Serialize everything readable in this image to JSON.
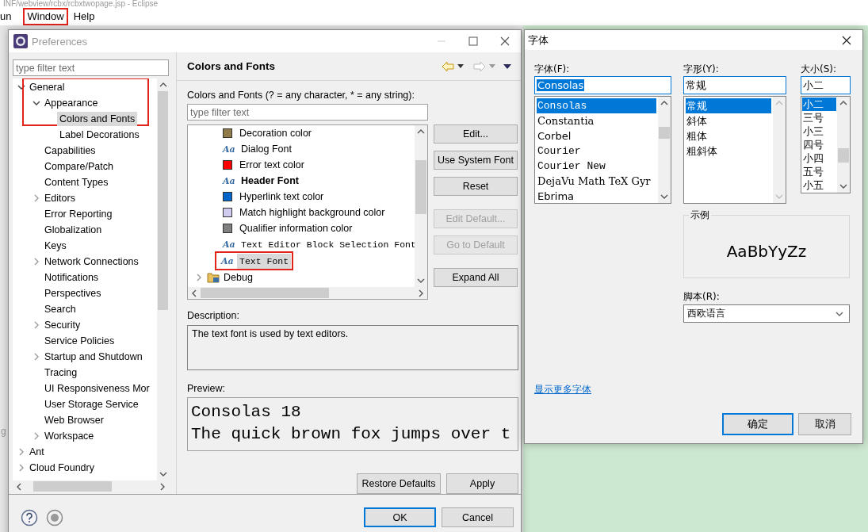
{
  "app_title": "INF/webview/rcbx/rcbxtwopage.jsp - Eclipse",
  "menu": [
    {
      "label": "un",
      "annotated": false
    },
    {
      "label": "Window",
      "annotated": true
    },
    {
      "label": "Help",
      "annotated": false
    }
  ],
  "edge_text": "g",
  "preferences": {
    "title": "Preferences",
    "filter_placeholder": "type filter text",
    "tree": [
      {
        "label": "General",
        "expanded": true,
        "selected": false,
        "annotated": true,
        "children": [
          {
            "label": "Appearance",
            "expanded": true,
            "selected": false,
            "children": [
              {
                "label": "Colors and Fonts",
                "selected": true
              },
              {
                "label": "Label Decorations",
                "selected": false
              }
            ]
          },
          {
            "label": "Capabilities",
            "selected": false
          },
          {
            "label": "Compare/Patch",
            "selected": false
          },
          {
            "label": "Content Types",
            "selected": false
          },
          {
            "label": "Editors",
            "expanded": false,
            "selected": false
          },
          {
            "label": "Error Reporting",
            "selected": false
          },
          {
            "label": "Globalization",
            "selected": false
          },
          {
            "label": "Keys",
            "selected": false
          },
          {
            "label": "Network Connections",
            "expanded": false,
            "selected": false
          },
          {
            "label": "Notifications",
            "selected": false
          },
          {
            "label": "Perspectives",
            "selected": false
          },
          {
            "label": "Search",
            "selected": false
          },
          {
            "label": "Security",
            "expanded": false,
            "selected": false
          },
          {
            "label": "Service Policies",
            "selected": false
          },
          {
            "label": "Startup and Shutdown",
            "expanded": false,
            "selected": false
          },
          {
            "label": "Tracing",
            "selected": false
          },
          {
            "label": "UI Responsiveness Mor",
            "selected": false
          },
          {
            "label": "User Storage Service",
            "selected": false
          },
          {
            "label": "Web Browser",
            "selected": false
          },
          {
            "label": "Workspace",
            "expanded": false,
            "selected": false
          }
        ]
      },
      {
        "label": "Ant",
        "expanded": false,
        "selected": false,
        "annotated": false
      },
      {
        "label": "Cloud Foundry",
        "expanded": false,
        "selected": false,
        "annotated": false
      }
    ],
    "page_title": "Colors and Fonts",
    "filter_label": "Colors and Fonts (? = any character, * = any string):",
    "list_filter_placeholder": "type filter text",
    "items": [
      {
        "kind": "color",
        "label": "Decoration color",
        "color": "#8f7a4a",
        "selected": false,
        "annotated": false
      },
      {
        "kind": "font",
        "icon": "Aa",
        "label": "Dialog Font",
        "bold": false,
        "monospace": false,
        "selected": false,
        "annotated": false
      },
      {
        "kind": "color",
        "label": "Error text color",
        "color": "#ff0000",
        "selected": false,
        "annotated": false
      },
      {
        "kind": "font",
        "icon": "Aa",
        "label": "Header Font",
        "bold": true,
        "monospace": false,
        "selected": false,
        "annotated": false
      },
      {
        "kind": "color",
        "label": "Hyperlink text color",
        "color": "#0066cc",
        "selected": false,
        "annotated": false
      },
      {
        "kind": "color",
        "label": "Match highlight background color",
        "color": "#d0ccf0",
        "selected": false,
        "annotated": false
      },
      {
        "kind": "color",
        "label": "Qualifier information color",
        "color": "#808080",
        "selected": false,
        "annotated": false
      },
      {
        "kind": "font",
        "icon": "Aa",
        "label": "Text Editor Block Selection Font",
        "bold": false,
        "monospace": true,
        "selected": false,
        "annotated": false
      },
      {
        "kind": "font",
        "icon": "Aa",
        "label": "Text Font",
        "bold": false,
        "monospace": true,
        "selected": true,
        "annotated": true
      },
      {
        "kind": "folder",
        "label": "Debug",
        "expanded": false,
        "selected": false,
        "annotated": false
      }
    ],
    "side_buttons": [
      {
        "label": "Edit...",
        "disabled": false
      },
      {
        "label": "Use System Font",
        "disabled": false
      },
      {
        "label": "Reset",
        "disabled": false
      },
      {
        "label": "Edit Default...",
        "disabled": true
      },
      {
        "label": "Go to Default",
        "disabled": true
      },
      {
        "label": "Expand All",
        "disabled": false
      }
    ],
    "description_label": "Description:",
    "description": "The text font is used by text editors.",
    "preview_label": "Preview:",
    "preview_lines": [
      "Consolas 18",
      "The quick brown fox jumps over t"
    ],
    "page_buttons": [
      {
        "label": "Restore Defaults"
      },
      {
        "label": "Apply"
      }
    ],
    "dialog_buttons": [
      {
        "label": "OK",
        "default": true
      },
      {
        "label": "Cancel",
        "default": false
      }
    ]
  },
  "font_dialog": {
    "title": "字体",
    "font_label": "字体(F):",
    "font_value": "Consolas",
    "font_value_highlighted": true,
    "fonts": [
      {
        "label": "Consolas",
        "kind": "mono",
        "selected": true
      },
      {
        "label": "Constantia",
        "kind": "serif",
        "selected": false
      },
      {
        "label": "Corbel",
        "kind": "sans",
        "selected": false
      },
      {
        "label": "Courier",
        "kind": "mono",
        "selected": false
      },
      {
        "label": "Courier New",
        "kind": "mono",
        "selected": false
      },
      {
        "label": "DejaVu Math TeX Gyr",
        "kind": "serif",
        "selected": false
      },
      {
        "label": "Ebrima",
        "kind": "sans",
        "selected": false
      }
    ],
    "style_label": "字形(Y):",
    "style_value": "常规",
    "styles": [
      {
        "label": "常规",
        "selected": true
      },
      {
        "label": "斜体",
        "selected": false
      },
      {
        "label": "粗体",
        "selected": false
      },
      {
        "label": "粗斜体",
        "selected": false
      }
    ],
    "size_label": "大小(S):",
    "size_value": "小二",
    "sizes": [
      {
        "label": "小二",
        "selected": true
      },
      {
        "label": "三号",
        "selected": false
      },
      {
        "label": "小三",
        "selected": false
      },
      {
        "label": "四号",
        "selected": false
      },
      {
        "label": "小四",
        "selected": false
      },
      {
        "label": "五号",
        "selected": false
      },
      {
        "label": "小五",
        "selected": false
      }
    ],
    "sample_label": "示例",
    "sample_text": "AaBbYyZz",
    "script_label": "脚本(R):",
    "script_value": "西欧语言",
    "more_fonts_link": "显示更多字体",
    "buttons": [
      {
        "label": "确定",
        "default": true
      },
      {
        "label": "取消",
        "default": false
      }
    ]
  }
}
